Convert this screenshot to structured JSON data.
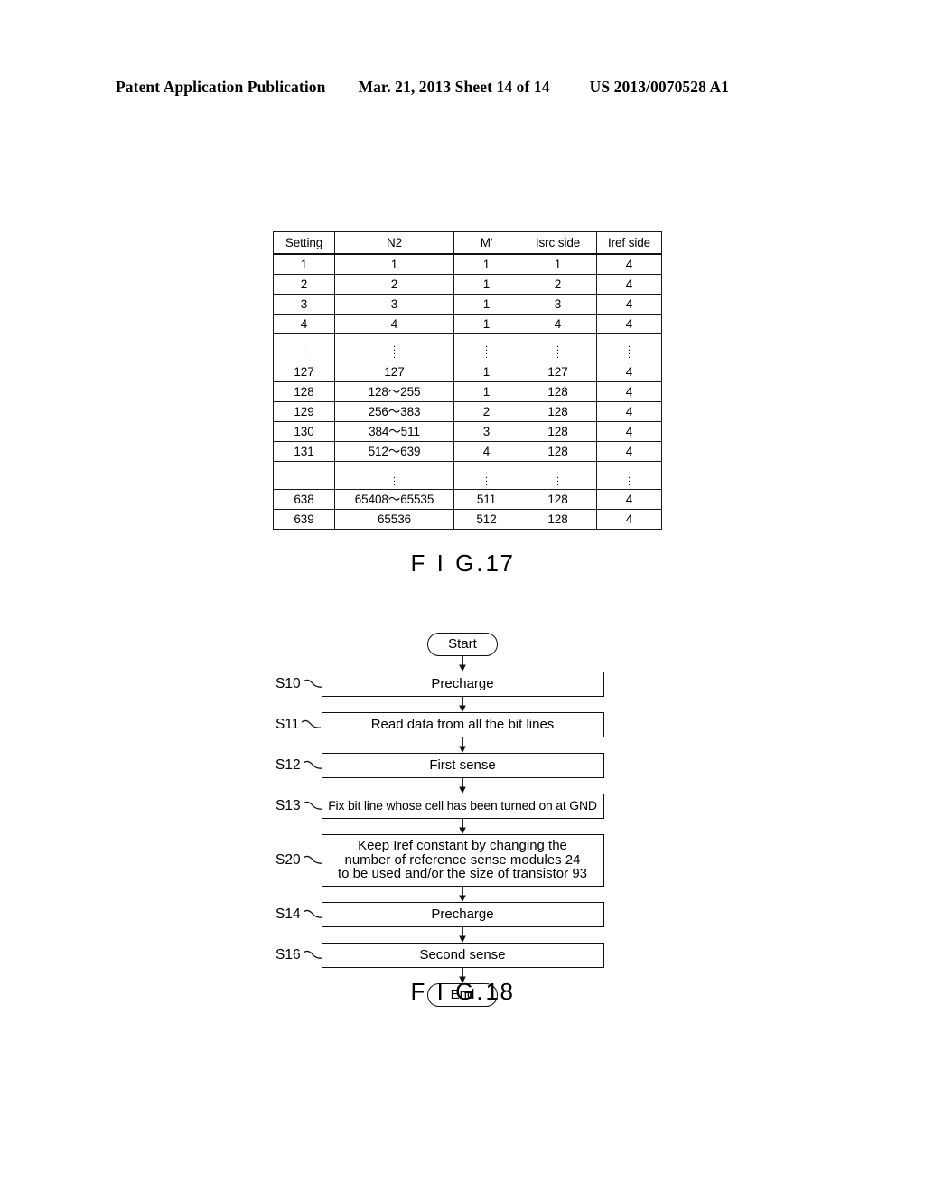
{
  "header": {
    "publication": "Patent Application Publication",
    "date_sheet": "Mar. 21, 2013  Sheet 14 of 14",
    "patent_number": "US 2013/0070528 A1"
  },
  "fig17": {
    "caption_fg": "F I G.",
    "caption_num": "17",
    "table": {
      "columns": [
        "Setting",
        "N2",
        "M'",
        "Isrc side",
        "Iref side"
      ],
      "rows": [
        {
          "type": "data",
          "cells": [
            "1",
            "1",
            "1",
            "1",
            "4"
          ]
        },
        {
          "type": "data",
          "cells": [
            "2",
            "2",
            "1",
            "2",
            "4"
          ]
        },
        {
          "type": "data",
          "cells": [
            "3",
            "3",
            "1",
            "3",
            "4"
          ]
        },
        {
          "type": "data",
          "cells": [
            "4",
            "4",
            "1",
            "4",
            "4"
          ]
        },
        {
          "type": "dots",
          "cells": [
            "",
            "",
            "",
            "",
            ""
          ]
        },
        {
          "type": "data",
          "cells": [
            "127",
            "127",
            "1",
            "127",
            "4"
          ]
        },
        {
          "type": "data",
          "cells": [
            "128",
            "128〜255",
            "1",
            "128",
            "4"
          ]
        },
        {
          "type": "data",
          "cells": [
            "129",
            "256〜383",
            "2",
            "128",
            "4"
          ]
        },
        {
          "type": "data",
          "cells": [
            "130",
            "384〜511",
            "3",
            "128",
            "4"
          ]
        },
        {
          "type": "data",
          "cells": [
            "131",
            "512〜639",
            "4",
            "128",
            "4"
          ]
        },
        {
          "type": "dots",
          "cells": [
            "",
            "",
            "",
            "",
            ""
          ]
        },
        {
          "type": "data",
          "cells": [
            "638",
            "65408〜65535",
            "511",
            "128",
            "4"
          ]
        },
        {
          "type": "data",
          "cells": [
            "639",
            "65536",
            "512",
            "128",
            "4"
          ]
        }
      ]
    }
  },
  "fig18": {
    "caption_fg": "F I G.",
    "caption_num": "18",
    "start_label": "Start",
    "end_label": "End",
    "steps": [
      {
        "id": "S10",
        "lines": [
          "Precharge"
        ]
      },
      {
        "id": "S11",
        "lines": [
          "Read data from all the bit lines"
        ]
      },
      {
        "id": "S12",
        "lines": [
          "First sense"
        ]
      },
      {
        "id": "S13",
        "lines": [
          "Fix bit line whose cell has been turned on at GND"
        ]
      },
      {
        "id": "S20",
        "lines": [
          "Keep Iref constant by changing the",
          "number of reference sense modules 24",
          "to be used and/or the size of transistor 93"
        ]
      },
      {
        "id": "S14",
        "lines": [
          "Precharge"
        ]
      },
      {
        "id": "S16",
        "lines": [
          "Second sense"
        ]
      }
    ]
  }
}
